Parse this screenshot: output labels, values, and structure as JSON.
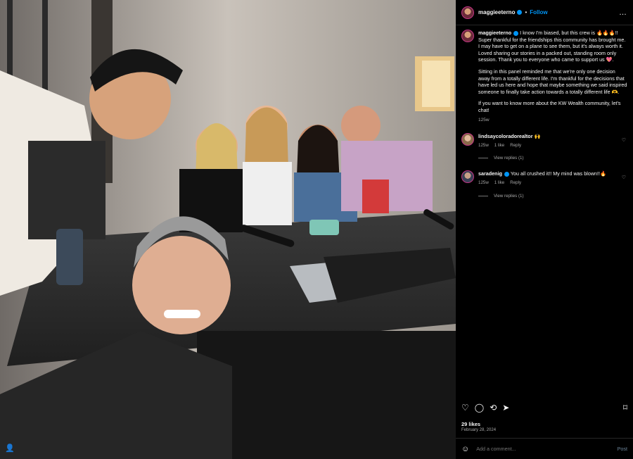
{
  "post": {
    "username": "maggieeterno",
    "follow_label": "Follow",
    "separator": "•",
    "more_icon": "…",
    "caption_p1": " I know I'm biased, but this crew is 🔥🔥🔥!! Super thankful for the friendships this community has brought me. I may have to get on a plane to see them, but it's always worth it. Loved sharing our stories in a packed out, standing room only session. Thank you to everyone who came to support us 💖.",
    "caption_p2": "Sitting in this panel reminded me that we're only one decision away from a totally different life. I'm thankful for the decisions that have led us here and hope that maybe something we said inspired someone to finally take action towards a totally different life 🫶.",
    "caption_p3": "If you want to know more about the KW Wealth community, let's chat!",
    "caption_age": "125w",
    "likes": "29 likes",
    "date": "February 28, 2024"
  },
  "comments": [
    {
      "user": "lindsaycoloradorealtor",
      "text": " 🙌",
      "age": "125w",
      "likes": "1 like",
      "reply": "Reply",
      "view_replies": "View replies (1)"
    },
    {
      "user": "saradenig",
      "text": " You all crushed it!! My mind was blown!!🔥",
      "age": "125w",
      "likes": "1 like",
      "reply": "Reply",
      "view_replies": "View replies (1)"
    }
  ],
  "actions": {
    "like_icon": "♡",
    "comment_icon": "◯",
    "share_icon": "⟲",
    "send_icon": "➤",
    "save_icon": "⌑"
  },
  "add_comment": {
    "emoji_icon": "☺",
    "placeholder": "Add a comment...",
    "post_label": "Post"
  },
  "photo": {
    "user_tag_icon": "👤"
  },
  "colors": {
    "accent": "#0095f6",
    "background": "#000000",
    "muted": "#a8a8a8"
  }
}
